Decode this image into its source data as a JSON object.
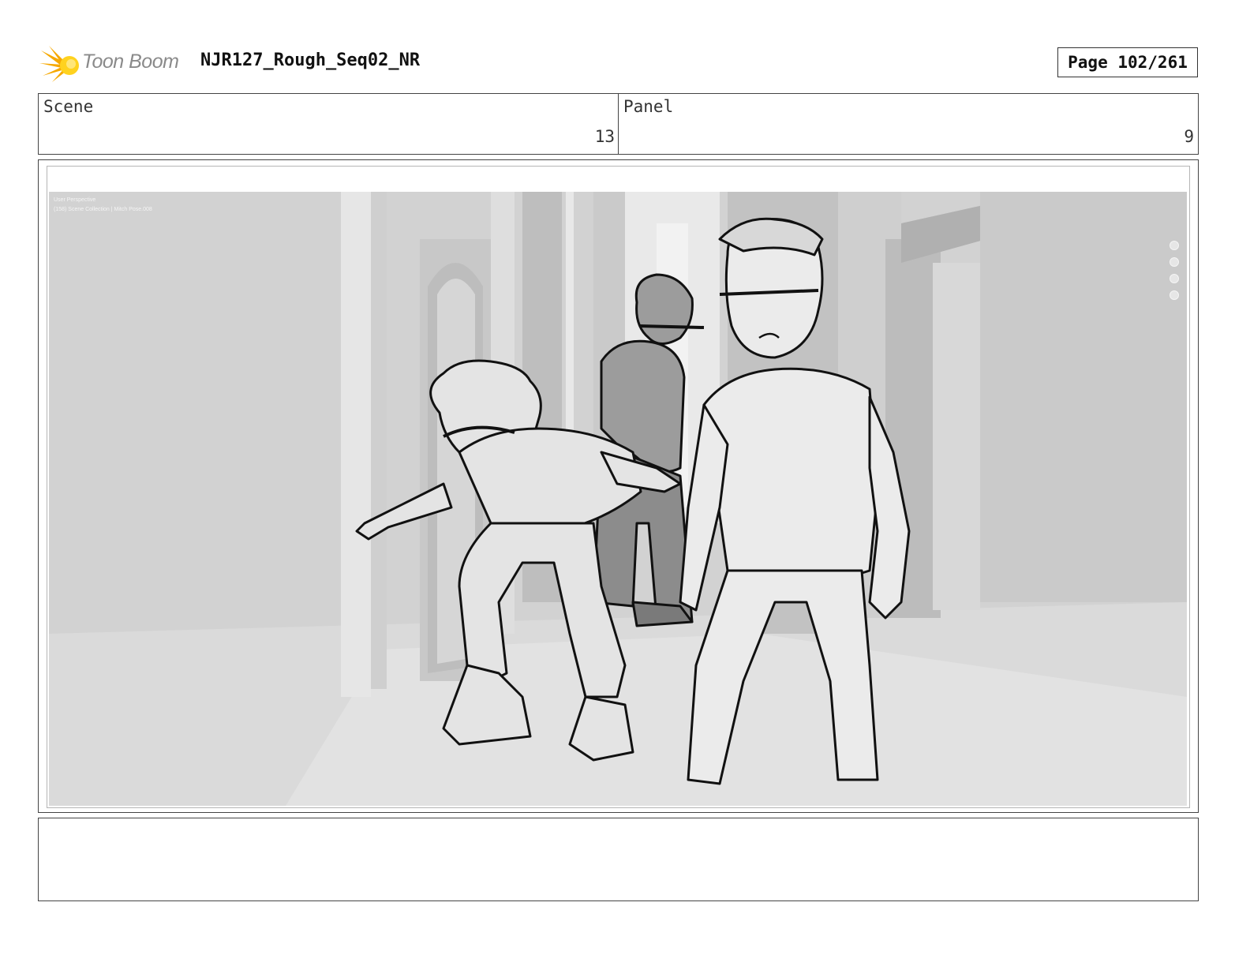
{
  "header": {
    "logo_text": "Toon Boom",
    "project_title": "NJR127_Rough_Seq02_NR",
    "page_label": "Page 102/261"
  },
  "info": {
    "scene_label": "Scene",
    "scene_value": "13",
    "panel_label": "Panel",
    "panel_value": "9"
  },
  "viewport": {
    "perspective_label": "User Perspective",
    "collection_label": "(158) Scene Collection | Mitch Pose.008",
    "tools": [
      "zoom-icon",
      "hand-icon",
      "camera-icon",
      "grid-icon"
    ]
  },
  "notes": {
    "text": ""
  },
  "colors": {
    "logo_orange": "#f6a800",
    "logo_yellow": "#ffd21f",
    "background_3d": "#d2d2d2",
    "sketch_ink": "#111111"
  }
}
